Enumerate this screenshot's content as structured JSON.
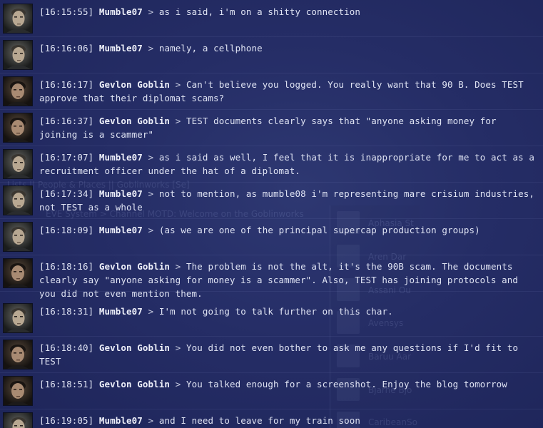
{
  "chat": {
    "separator": ">",
    "messages": [
      {
        "time": "[16:15:55]",
        "sender": "Mumble07",
        "text": "as i said, i'm on a shitty connection",
        "avatar": "mumble07-portrait"
      },
      {
        "time": "[16:16:06]",
        "sender": "Mumble07",
        "text": "namely, a cellphone",
        "avatar": "mumble07-portrait"
      },
      {
        "time": "[16:16:17]",
        "sender": "Gevlon Goblin",
        "text": "Can't believe you logged. You really want that 90 B. Does TEST approve that their diplomat scams?",
        "avatar": "gevlon-goblin-portrait"
      },
      {
        "time": "[16:16:37]",
        "sender": "Gevlon Goblin",
        "text": "TEST documents clearly says that \"anyone asking money for joining is a scammer\"",
        "avatar": "gevlon-goblin-portrait"
      },
      {
        "time": "[16:17:07]",
        "sender": "Mumble07",
        "text": "as i said as well, I feel that it is inappropriate for me to act as a recruitment officer under the hat of a diplomat.",
        "avatar": "mumble07-portrait"
      },
      {
        "time": "[16:17:34]",
        "sender": "Mumble07",
        "text": "not to mention, as mumble08 i'm representing mare crisium industries, not TEST as a whole",
        "avatar": "mumble07-portrait"
      },
      {
        "time": "[16:18:09]",
        "sender": "Mumble07",
        "text": "(as we are one of the principal supercap production groups)",
        "avatar": "mumble07-portrait"
      },
      {
        "time": "[16:18:16]",
        "sender": "Gevlon Goblin",
        "text": "The problem is not the alt, it's the 90B scam. The documents clearly say \"anyone asking for money is a scammer\". Also, TEST has joining protocols and you did not even mention them.",
        "avatar": "gevlon-goblin-portrait"
      },
      {
        "time": "[16:18:31]",
        "sender": "Mumble07",
        "text": "I'm not going to talk further on this char.",
        "avatar": "mumble07-portrait"
      },
      {
        "time": "[16:18:40]",
        "sender": "Gevlon Goblin",
        "text": "You did not even bother to ask me any questions if I'd fit to TEST",
        "avatar": "gevlon-goblin-portrait"
      },
      {
        "time": "[16:18:51]",
        "sender": "Gevlon Goblin",
        "text": "You talked enough for a screenshot. Enjoy the blog tomorrow",
        "avatar": "gevlon-goblin-portrait"
      },
      {
        "time": "[16:19:05]",
        "sender": "Mumble07",
        "text": "and I need to leave for my train soon",
        "avatar": "mumble07-portrait"
      }
    ]
  },
  "background": {
    "channel_tabs": "Lists || People & Places || Goblinworks [Se]",
    "motd": "EVE System > Channel MOTD: Welcome on the Goblinworks",
    "members": [
      "Aphasia St",
      "Aren Dar",
      "Assani Ou",
      "Avensys",
      "Baruu Aar",
      "Bjarne Bjo",
      "CaribeanSo"
    ]
  },
  "colors": {
    "background": "#252d66",
    "text": "#dfe3f3",
    "name": "#eef0fa"
  }
}
